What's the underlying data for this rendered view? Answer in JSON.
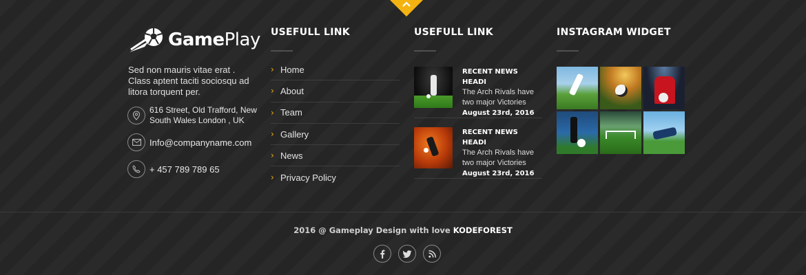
{
  "brand": {
    "logo_bold": "Game",
    "logo_light": "Play"
  },
  "about": "Sed non mauris vitae erat . Class aptent taciti sociosqu ad litora torquent per.",
  "contact": {
    "address_line1": "616 Street, Old Trafford, New",
    "address_line2": "South Wales London , UK",
    "email": "Info@companyname.com",
    "phone": "+ 457 789 789 65"
  },
  "columns": {
    "links_heading": "USEFULL LINK",
    "news_heading": "USEFULL LINK",
    "instagram_heading": "INSTAGRAM WIDGET"
  },
  "links": [
    "Home",
    "About",
    "Team",
    "Gallery",
    "News",
    "Privacy Policy"
  ],
  "news": [
    {
      "title": "RECENT NEWS HEADI",
      "desc1": "The Arch Rivals have",
      "desc2": "two major Victories",
      "date": "August 23rd, 2016"
    },
    {
      "title": "RECENT NEWS HEADI",
      "desc1": "The Arch Rivals have",
      "desc2": "two major Victories",
      "date": "August 23rd, 2016"
    }
  ],
  "footer": {
    "copyright": "2016 @ Gameplay Design with love",
    "brand": "KODEFOREST"
  },
  "colors": {
    "accent": "#f5b311",
    "background": "#262626"
  },
  "icons": [
    "chevron-up-icon",
    "location-icon",
    "mail-icon",
    "phone-icon",
    "facebook-icon",
    "twitter-icon",
    "rss-icon"
  ]
}
